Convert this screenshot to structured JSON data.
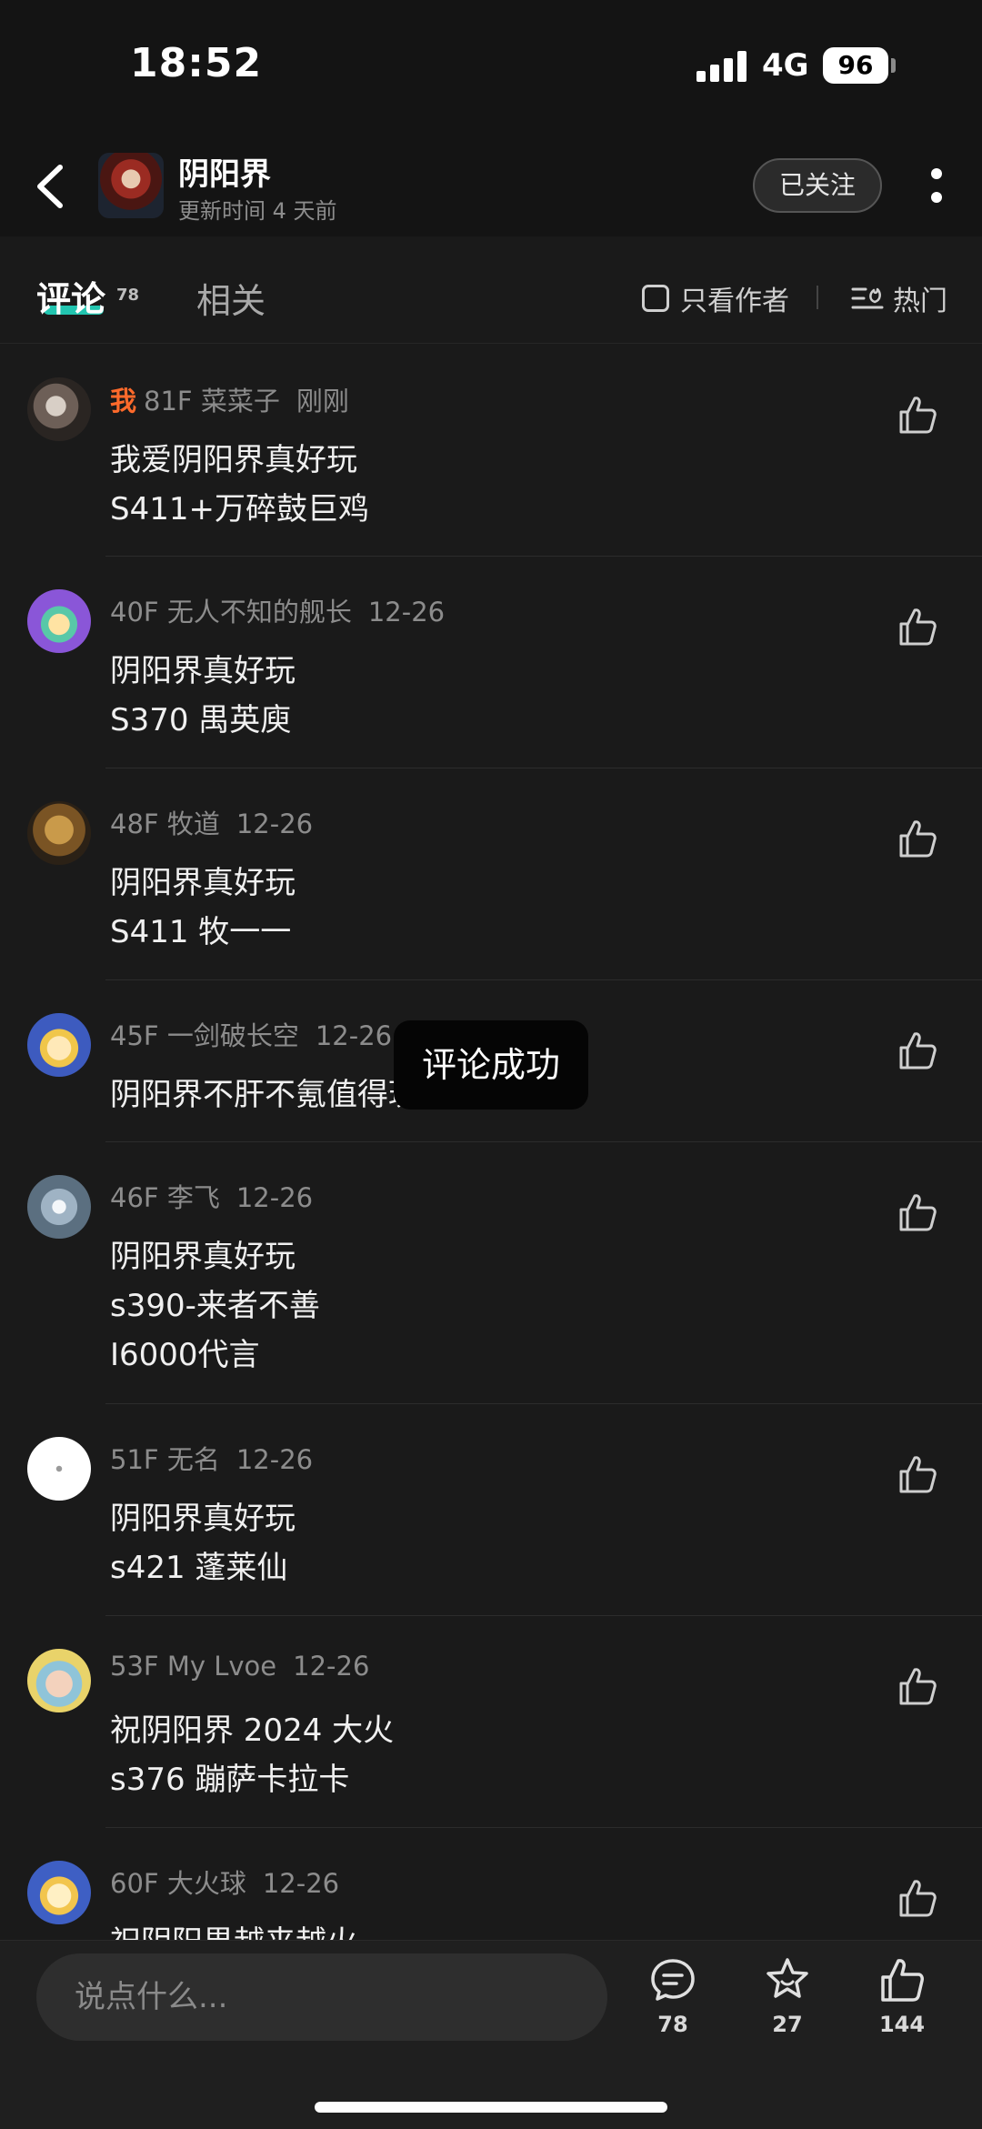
{
  "status_bar": {
    "time": "18:52",
    "network": "4G",
    "battery": "96"
  },
  "header": {
    "back_icon": "chevron-left-icon",
    "title": "阴阳界",
    "subtitle": "更新时间 4 天前",
    "follow_label": "已关注",
    "more_icon": "more-vertical-icon"
  },
  "tabs": {
    "comments_label": "评论",
    "comments_count": "78",
    "related_label": "相关",
    "author_only_label": "只看作者",
    "sort_label": "热门",
    "accent_color": "#22c5b0"
  },
  "comments": [
    {
      "me_tag": "我",
      "floor": "81F",
      "author": "菜菜子",
      "date": "刚刚",
      "lines": [
        "我爱阴阳界真好玩",
        "S411+万碎鼓巨鸡"
      ]
    },
    {
      "floor": "40F",
      "author": "无人不知的舰长",
      "date": "12-26",
      "lines": [
        "阴阳界真好玩",
        "S370 禺英庾"
      ]
    },
    {
      "floor": "48F",
      "author": "牧道",
      "date": "12-26",
      "lines": [
        "阴阳界真好玩",
        "S411 牧一一"
      ]
    },
    {
      "floor": "45F",
      "author": "一剑破长空",
      "date": "12-26",
      "lines": [
        "阴阳界不肝不氪值得玩"
      ]
    },
    {
      "floor": "46F",
      "author": "李飞",
      "date": "12-26",
      "lines": [
        "阴阳界真好玩",
        "s390-来者不善",
        "I6000代言"
      ]
    },
    {
      "floor": "51F",
      "author": "无名",
      "date": "12-26",
      "lines": [
        "阴阳界真好玩",
        "s421  蓬莱仙"
      ]
    },
    {
      "floor": "53F",
      "author": "My Lvoe",
      "date": "12-26",
      "lines": [
        "祝阴阳界 2024 大火",
        "s376 蹦萨卡拉卡"
      ]
    },
    {
      "floor": "60F",
      "author": "大火球",
      "date": "12-26",
      "lines": [
        "祝阴阳界越来越火"
      ]
    }
  ],
  "toast": "评论成功",
  "bottom_bar": {
    "input_placeholder": "说点什么...",
    "comment_count": "78",
    "favorite_count": "27",
    "like_count": "144"
  }
}
